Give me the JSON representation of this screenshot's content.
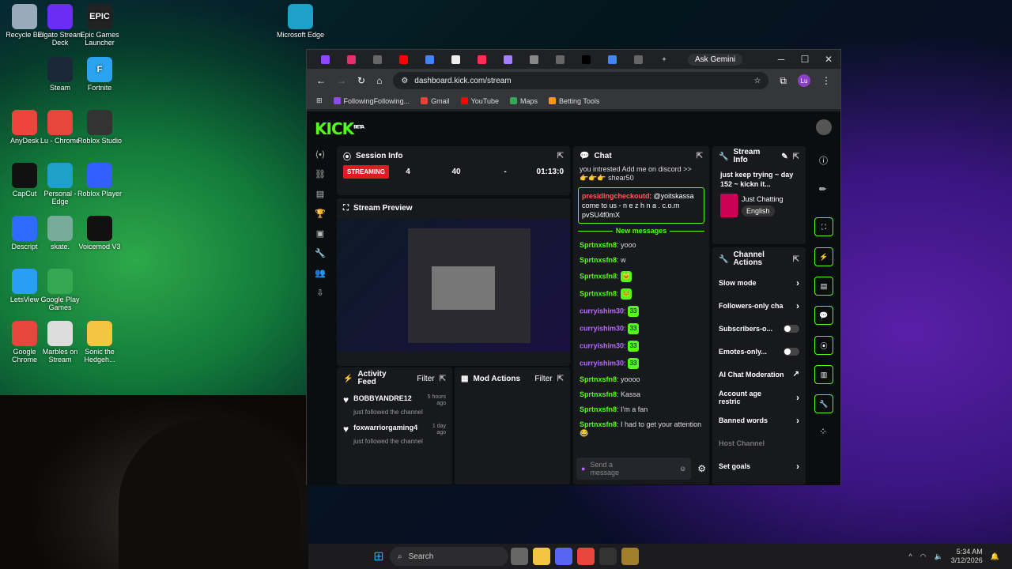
{
  "desktop_icons": [
    {
      "label": "Recycle Bin",
      "icon": "recycle-bin-icon",
      "color": "#9ab"
    },
    {
      "label": "Elgato Stream Deck",
      "icon": "stream-deck-icon",
      "color": "#6b2cf5"
    },
    {
      "label": "Epic Games Launcher",
      "icon": "epic-games-icon",
      "color": "#222",
      "glyph": "EPIC"
    },
    {
      "label": "Microsoft Edge",
      "icon": "edge-icon",
      "color": "#1da1c9"
    },
    {
      "label": "Steam",
      "icon": "steam-icon",
      "color": "#1b2838"
    },
    {
      "label": "Fortnite",
      "icon": "fortnite-icon",
      "color": "#2aa3f0",
      "glyph": "F"
    },
    {
      "label": "AnyDesk",
      "icon": "anydesk-icon",
      "color": "#ef443b"
    },
    {
      "label": "Lu - Chrome",
      "icon": "chrome-icon",
      "color": "#e8453c"
    },
    {
      "label": "Roblox Studio",
      "icon": "roblox-studio-icon",
      "color": "#333"
    },
    {
      "label": "CapCut",
      "icon": "capcut-icon",
      "color": "#111"
    },
    {
      "label": "Personal - Edge",
      "icon": "edge-icon",
      "color": "#1da1c9"
    },
    {
      "label": "Roblox Player",
      "icon": "roblox-icon",
      "color": "#335fff"
    },
    {
      "label": "Descript",
      "icon": "descript-icon",
      "color": "#2f6bff"
    },
    {
      "label": "skate.",
      "icon": "skate-icon",
      "color": "#7a9"
    },
    {
      "label": "Voicemod V3",
      "icon": "voicemod-icon",
      "color": "#111"
    },
    {
      "label": "LetsView",
      "icon": "letsview-icon",
      "color": "#2a9df4"
    },
    {
      "label": "Google Play Games",
      "icon": "play-games-icon",
      "color": "#34a853"
    },
    {
      "label": "Google Chrome",
      "icon": "chrome-icon",
      "color": "#e8453c"
    },
    {
      "label": "Marbles on Stream",
      "icon": "marbles-icon",
      "color": "#ddd"
    },
    {
      "label": "Sonic the Hedgeh...",
      "icon": "folder-icon",
      "color": "#f4c542"
    }
  ],
  "browser": {
    "url": "dashboard.kick.com/stream",
    "ask_gemini": "Ask Gemini",
    "profile": "Lu",
    "tab_colors": [
      "#9146ff",
      "#e1306c",
      "#666",
      "#ff0000",
      "#4285f4",
      "#eee",
      "#ff2d55",
      "#a37eff",
      "#888",
      "#666",
      "#000",
      "#4285f4",
      "#666"
    ],
    "bookmarks": [
      {
        "label": "FollowingFollowing...",
        "color": "#9146ff"
      },
      {
        "label": "Gmail",
        "color": "#ea4335"
      },
      {
        "label": "YouTube",
        "color": "#ff0000"
      },
      {
        "label": "Maps",
        "color": "#34a853"
      },
      {
        "label": "Betting Tools",
        "color": "#f90"
      }
    ]
  },
  "kick": {
    "logo": "KICK",
    "beta": "BETA",
    "session": {
      "title": "Session Info",
      "status": "STREAMING",
      "stats": [
        "4",
        "40",
        "-",
        "01:13:0"
      ]
    },
    "preview": {
      "title": "Stream Preview"
    },
    "activity": {
      "title": "Activity Feed",
      "filter": "Filter",
      "items": [
        {
          "user": "BOBBYANDRE12",
          "time": "5 hours ago",
          "text": "just followed the channel"
        },
        {
          "user": "foxwarriorgaming4",
          "time": "1 day ago",
          "text": "just followed the channel"
        }
      ]
    },
    "mod": {
      "title": "Mod Actions",
      "filter": "Filter"
    },
    "chat": {
      "title": "Chat",
      "top_text": "you intrested Add me on discord >>",
      "top_text2": "👉👉👉 shear50",
      "highlight_user": "presidingcheckoutd",
      "highlight_text": ": @yoitskassa come to us - n e z h n a . c.o.m pvSU4f0mX",
      "new_messages": "New messages",
      "messages": [
        {
          "user": "Sprtnxsfn8",
          "text": ": yooo",
          "kind": "u1"
        },
        {
          "user": "Sprtnxsfn8",
          "text": ": w",
          "kind": "u1"
        },
        {
          "user": "Sprtnxsfn8",
          "text": ":",
          "kind": "u1",
          "emote": "🐱"
        },
        {
          "user": "Sprtnxsfn8",
          "text": ":",
          "kind": "u1",
          "emote": "🐸"
        },
        {
          "user": "curryishim30",
          "text": ":",
          "kind": "u2",
          "emote": "33"
        },
        {
          "user": "curryishim30",
          "text": ":",
          "kind": "u2",
          "emote": "33"
        },
        {
          "user": "curryishim30",
          "text": ":",
          "kind": "u2",
          "emote": "33"
        },
        {
          "user": "curryishim30",
          "text": ":",
          "kind": "u2",
          "emote": "33"
        },
        {
          "user": "Sprtnxsfn8",
          "text": ": yoooo",
          "kind": "u1"
        },
        {
          "user": "Sprtnxsfn8",
          "text": ": Kassa",
          "kind": "u1"
        },
        {
          "user": "Sprtnxsfn8",
          "text": ": I'm a fan",
          "kind": "u1"
        },
        {
          "user": "Sprtnxsfn8",
          "text": ": I had to get your attention 😂",
          "kind": "u1"
        }
      ],
      "placeholder": "Send a message"
    },
    "stream_info": {
      "title": "Stream Info",
      "stream_title": "just keep trying ~ day 152 ~ kickn it...",
      "category": "Just Chatting",
      "language": "English"
    },
    "channel_actions": {
      "title": "Channel Actions",
      "items": [
        {
          "label": "Slow mode",
          "ctl": "chev"
        },
        {
          "label": "Followers-only cha",
          "ctl": "chev"
        },
        {
          "label": "Subscribers-o...",
          "ctl": "toggle"
        },
        {
          "label": "Emotes-only...",
          "ctl": "toggle"
        },
        {
          "label": "AI Chat Moderation",
          "ctl": "ext"
        },
        {
          "label": "Account age restric",
          "ctl": "chev"
        },
        {
          "label": "Banned words",
          "ctl": "chev"
        },
        {
          "label": "Host Channel",
          "ctl": "none"
        },
        {
          "label": "Set goals",
          "ctl": "chev"
        }
      ]
    }
  },
  "taskbar": {
    "search": "Search",
    "time": "5:34 AM",
    "date": "3/12/2026"
  }
}
